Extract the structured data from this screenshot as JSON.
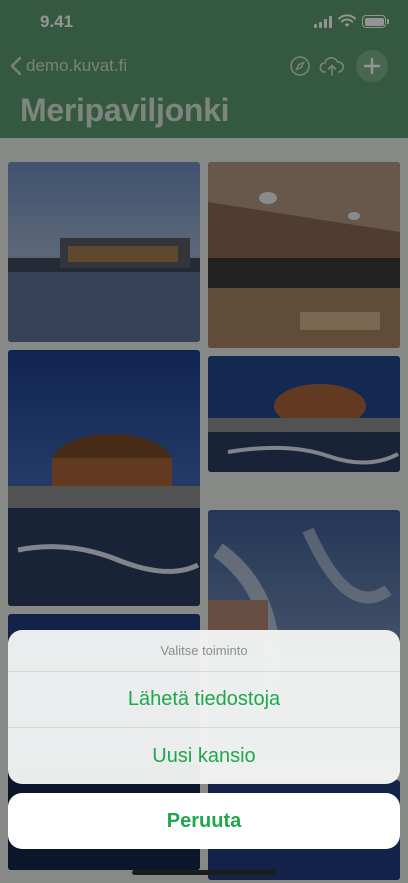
{
  "status_bar": {
    "time": "9.41"
  },
  "nav": {
    "back_label": "demo.kuvat.fi",
    "title": "Meripaviljonki",
    "icons": [
      "compass-icon",
      "cloud-upload-icon",
      "plus-icon"
    ]
  },
  "gallery": {
    "photos": [
      "waterfront-pavilion",
      "restaurant-interior",
      "pavilion-dusk",
      "pavilion-pier",
      "cloudy-sky",
      "night-photo",
      "night-photo-2"
    ]
  },
  "action_sheet": {
    "title": "Valitse toiminto",
    "actions": [
      {
        "label": "Lähetä tiedostoja"
      },
      {
        "label": "Uusi kansio"
      }
    ],
    "cancel_label": "Peruuta"
  },
  "colors": {
    "header": "#5c9a6f",
    "accent": "#1fa84b",
    "sheet_bg": "#f4f5f4"
  }
}
